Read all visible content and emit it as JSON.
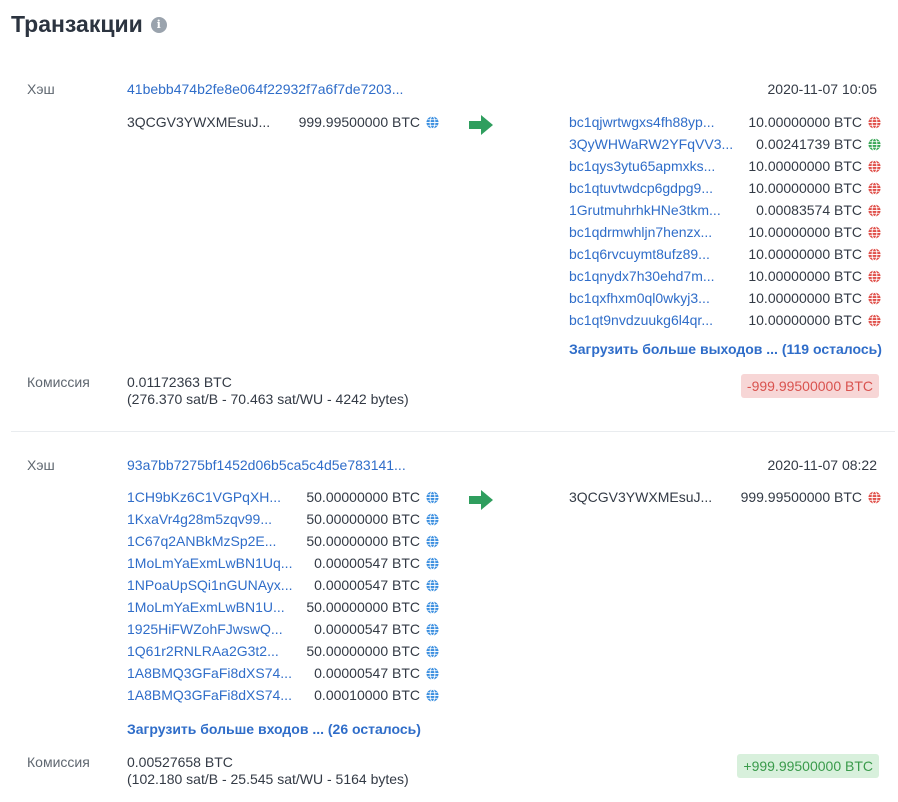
{
  "page": {
    "title": "Транзакции"
  },
  "transactions": [
    {
      "hash_label": "Хэш",
      "hash": "41bebb474b2fe8e064f22932f7a6f7de7203...",
      "time": "2020-11-07 10:05",
      "inputs": [
        {
          "address": "3QCGV3YWXMEsuJ...",
          "amount": "999.99500000 BTC",
          "globe": "blue"
        }
      ],
      "outputs": [
        {
          "address": "bc1qjwrtwgxs4fh88yp...",
          "amount": "10.00000000 BTC",
          "globe": "red"
        },
        {
          "address": "3QyWHWaRW2YFqVV3...",
          "amount": "0.00241739 BTC",
          "globe": "green"
        },
        {
          "address": "bc1qys3ytu65apmxks...",
          "amount": "10.00000000 BTC",
          "globe": "red"
        },
        {
          "address": "bc1qtuvtwdcp6gdpg9...",
          "amount": "10.00000000 BTC",
          "globe": "red"
        },
        {
          "address": "1GrutmuhrhkHNe3tkm...",
          "amount": "0.00083574 BTC",
          "globe": "red"
        },
        {
          "address": "bc1qdrmwhljn7henzx...",
          "amount": "10.00000000 BTC",
          "globe": "red"
        },
        {
          "address": "bc1q6rvcuymt8ufz89...",
          "amount": "10.00000000 BTC",
          "globe": "red"
        },
        {
          "address": "bc1qnydx7h30ehd7m...",
          "amount": "10.00000000 BTC",
          "globe": "red"
        },
        {
          "address": "bc1qxfhxm0ql0wkyj3...",
          "amount": "10.00000000 BTC",
          "globe": "red"
        },
        {
          "address": "bc1qt9nvdzuukg6l4qr...",
          "amount": "10.00000000 BTC",
          "globe": "red"
        }
      ],
      "load_more": "Загрузить больше выходов ... (119 осталось)",
      "fee_label": "Комиссия",
      "fee_value": "0.01172363 BTC",
      "fee_detail": "(276.370 sat/B - 70.463 sat/WU - 4242 bytes)",
      "net": "-999.99500000 BTC"
    },
    {
      "hash_label": "Хэш",
      "hash": "93a7bb7275bf1452d06b5ca5c4d5e783141...",
      "time": "2020-11-07 08:22",
      "inputs": [
        {
          "address": "1CH9bKz6C1VGPqXH...",
          "amount": "50.00000000 BTC",
          "globe": "blue"
        },
        {
          "address": "1KxaVr4g28m5zqv99...",
          "amount": "50.00000000 BTC",
          "globe": "blue"
        },
        {
          "address": "1C67q2ANBkMzSp2E...",
          "amount": "50.00000000 BTC",
          "globe": "blue"
        },
        {
          "address": "1MoLmYaExmLwBN1Uq...",
          "amount": "0.00000547 BTC",
          "globe": "blue"
        },
        {
          "address": "1NPoaUpSQi1nGUNAyx...",
          "amount": "0.00000547 BTC",
          "globe": "blue"
        },
        {
          "address": "1MoLmYaExmLwBN1U...",
          "amount": "50.00000000 BTC",
          "globe": "blue"
        },
        {
          "address": "1925HiFWZohFJwswQ...",
          "amount": "0.00000547 BTC",
          "globe": "blue"
        },
        {
          "address": "1Q61r2RNLRAa2G3t2...",
          "amount": "50.00000000 BTC",
          "globe": "blue"
        },
        {
          "address": "1A8BMQ3GFaFi8dXS74...",
          "amount": "0.00000547 BTC",
          "globe": "blue"
        },
        {
          "address": "1A8BMQ3GFaFi8dXS74...",
          "amount": "0.00010000 BTC",
          "globe": "blue"
        }
      ],
      "outputs": [
        {
          "address": "3QCGV3YWXMEsuJ...",
          "amount": "999.99500000 BTC",
          "globe": "red"
        }
      ],
      "load_more": "Загрузить больше входов ... (26 осталось)",
      "fee_label": "Комиссия",
      "fee_value": "0.00527658 BTC",
      "fee_detail": "(102.180 sat/B - 25.545 sat/WU - 5164 bytes)",
      "net": "+999.99500000 BTC"
    }
  ],
  "colors": {
    "link": "#2f6dc9",
    "globe_blue": "#3b8fe0",
    "globe_red": "#e0504a",
    "globe_green": "#3aa657",
    "arrow": "#2f9e5e"
  }
}
